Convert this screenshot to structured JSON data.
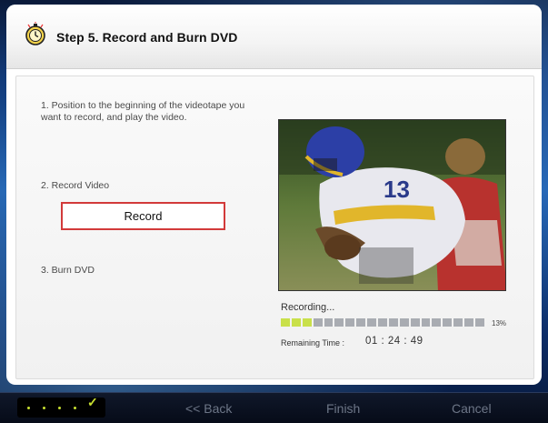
{
  "header": {
    "title": "Step 5. Record and Burn DVD",
    "icon": "timer-icon"
  },
  "instructions": {
    "step1": "1. Position to the beginning of the videotape you want to record, and play the video.",
    "step2": "2. Record Video",
    "step3": "3. Burn DVD"
  },
  "record_button": {
    "label": "Record"
  },
  "video_preview": {
    "description_icon": "video-preview-image"
  },
  "status": {
    "text": "Recording...",
    "progress_percent_label": "13%",
    "progress_fraction": 0.13,
    "segments_total": 19,
    "segments_filled": 3,
    "remaining_label": "Remaining Time :",
    "remaining_value": "01 : 24 : 49"
  },
  "footer": {
    "step_dots_total": 4,
    "back_label": "<< Back",
    "finish_label": "Finish",
    "cancel_label": "Cancel"
  },
  "colors": {
    "accent_green": "#c8e030",
    "record_border": "#d23a3a",
    "nav_text": "#6d7687"
  }
}
